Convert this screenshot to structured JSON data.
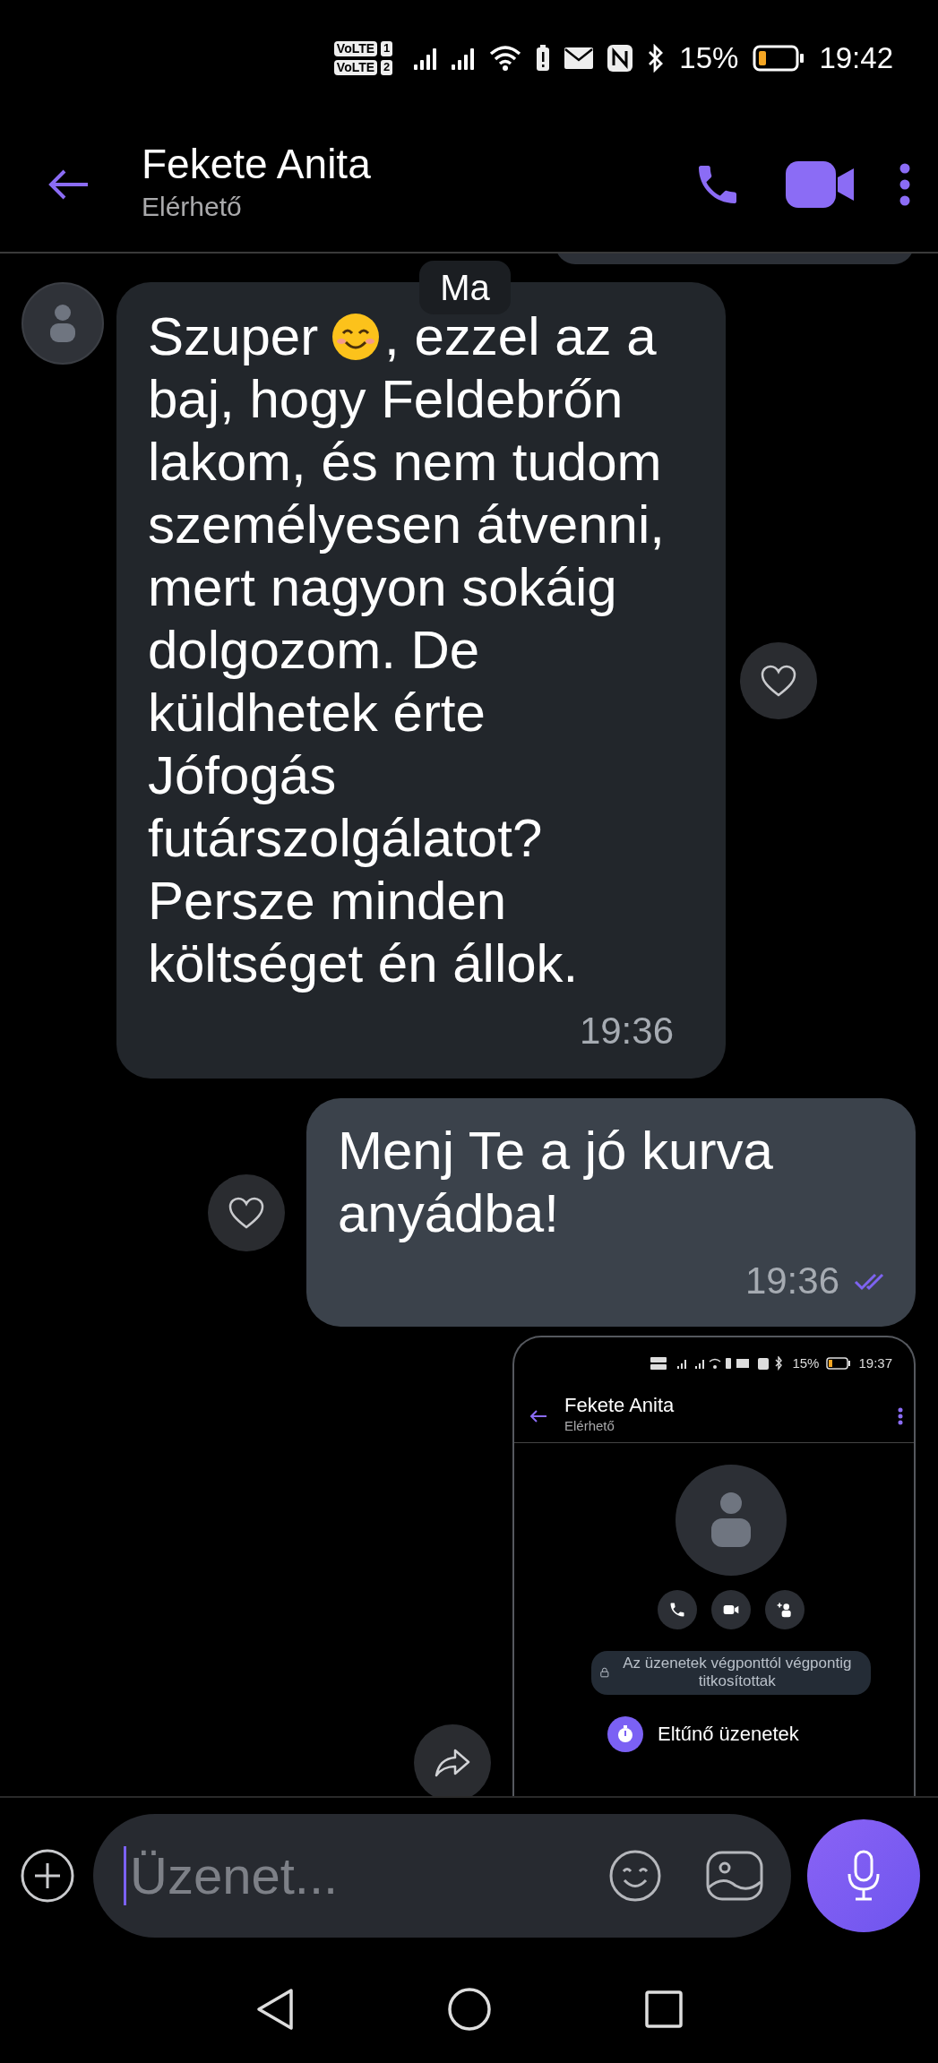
{
  "status_bar": {
    "sims": [
      {
        "badge": "VoLTE",
        "slot": "1"
      },
      {
        "badge": "VoLTE",
        "slot": "2"
      }
    ],
    "battery_text": "15%",
    "time": "19:42"
  },
  "header": {
    "title": "Fekete Anita",
    "subtitle": "Elérhető"
  },
  "date_chip": "Ma",
  "messages": [
    {
      "kind": "incoming",
      "parts": [
        {
          "kind": "text",
          "text": "Szuper"
        },
        {
          "kind": "emoji"
        },
        {
          "kind": "text",
          "text": ", ezzel az a"
        },
        {
          "kind": "paragraph",
          "text": "baj, hogy Feldebrőn lakom, és nem tudom személyesen átvenni, mert nagyon sokáig dolgozom. De küldhetek érte Jófogás futárszolgálatot? Persze minden költséget én állok."
        }
      ],
      "time": "19:36"
    },
    {
      "kind": "outgoing",
      "parts": [
        {
          "kind": "paragraph",
          "text": "Menj Te a jó kurva anyádba!"
        }
      ],
      "time": "19:36",
      "read": true
    },
    {
      "kind": "screenshot",
      "shot": {
        "battery_text": "15%",
        "time": "19:37",
        "title": "Fekete Anita",
        "subtitle": "Elérhető",
        "note": "Az üzenetek végponttól végpontig titkosítottak",
        "disappearing_label": "Eltűnő üzenetek"
      }
    }
  ],
  "composer": {
    "placeholder": "Üzenet..."
  }
}
